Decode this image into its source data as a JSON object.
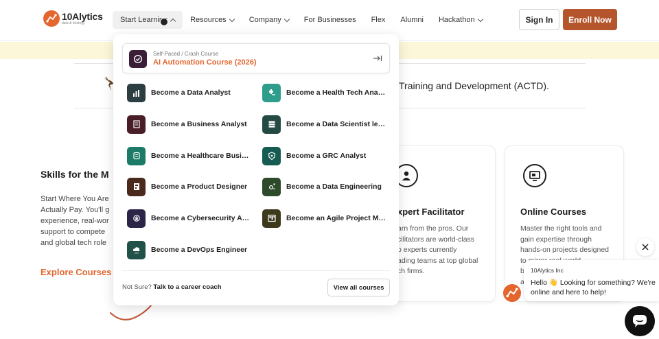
{
  "brand": {
    "name": "10Alytics",
    "tagline": "data & strategy"
  },
  "nav": {
    "items": [
      {
        "label": "Start Learning",
        "dropdown": true,
        "active": true
      },
      {
        "label": "Resources",
        "dropdown": true
      },
      {
        "label": "Company",
        "dropdown": true
      },
      {
        "label": "For Businesses",
        "dropdown": false
      },
      {
        "label": "Flex",
        "dropdown": false
      },
      {
        "label": "Alumni",
        "dropdown": false
      },
      {
        "label": "Hackathon",
        "dropdown": true
      }
    ],
    "signin_label": "Sign In",
    "enroll_label": "Enroll Now"
  },
  "page": {
    "actd_text": "Training and Development (ACTD).",
    "skills_title": "Skills for the M",
    "skills_lines": [
      "Start Where You Are",
      "Actually Pay. You'll g",
      "experience, real-wor",
      "support to compete",
      "and global tech role"
    ],
    "explore_label": "Explore Courses",
    "cards": [
      {
        "title": "xpert Facilitator",
        "lines": [
          "arn from the pros. Our",
          "cilitators are world-class",
          "o experts currently",
          "ading teams at top global",
          "ch firms."
        ],
        "icon": "user-icon"
      },
      {
        "title": "Online Courses",
        "lines": [
          "Master the right tools and",
          "gain expertise through",
          "hands-on projects designed",
          "to mirror real-world",
          "bu",
          "ar"
        ],
        "icon": "screen-icon"
      }
    ]
  },
  "menu": {
    "featured": {
      "subtitle": "Self-Paced / Crash Course",
      "title": "AI Automation Course (2026)"
    },
    "items": [
      {
        "label": "Become a Data Analyst",
        "color": "#2c3e42",
        "icon": "bar-chart-icon"
      },
      {
        "label": "Become a Health Tech Analyst",
        "color": "#2f9d8b",
        "icon": "health-icon"
      },
      {
        "label": "Become a Business Analyst",
        "color": "#4a1e26",
        "icon": "document-icon"
      },
      {
        "label": "Become a Data Scientist leve...",
        "color": "#244a43",
        "icon": "database-icon"
      },
      {
        "label": "Become a Healthcare Busine...",
        "color": "#1d7a66",
        "icon": "list-icon"
      },
      {
        "label": "Become a GRC Analyst",
        "color": "#175c52",
        "icon": "shield-icon"
      },
      {
        "label": "Become a Product Designer",
        "color": "#4b2a1e",
        "icon": "design-icon"
      },
      {
        "label": "Become a Data Engineering",
        "color": "#2d4a2a",
        "icon": "gear-icon"
      },
      {
        "label": "Become a Cybersecurity An...",
        "color": "#2d2548",
        "icon": "lock-icon"
      },
      {
        "label": "Become an Agile Project Ma...",
        "color": "#3d3a1c",
        "icon": "board-icon"
      },
      {
        "label": "Become a DevOps Engineer",
        "color": "#21524a",
        "icon": "cloud-icon"
      }
    ],
    "footer_prefix": "Not Sure?",
    "footer_link": "Talk to a career coach",
    "view_all_label": "View all courses"
  },
  "chat": {
    "from": "10Alytics Inc",
    "line1": "Hello 👋 Looking for something? We're",
    "line2": "online and here to help!"
  }
}
